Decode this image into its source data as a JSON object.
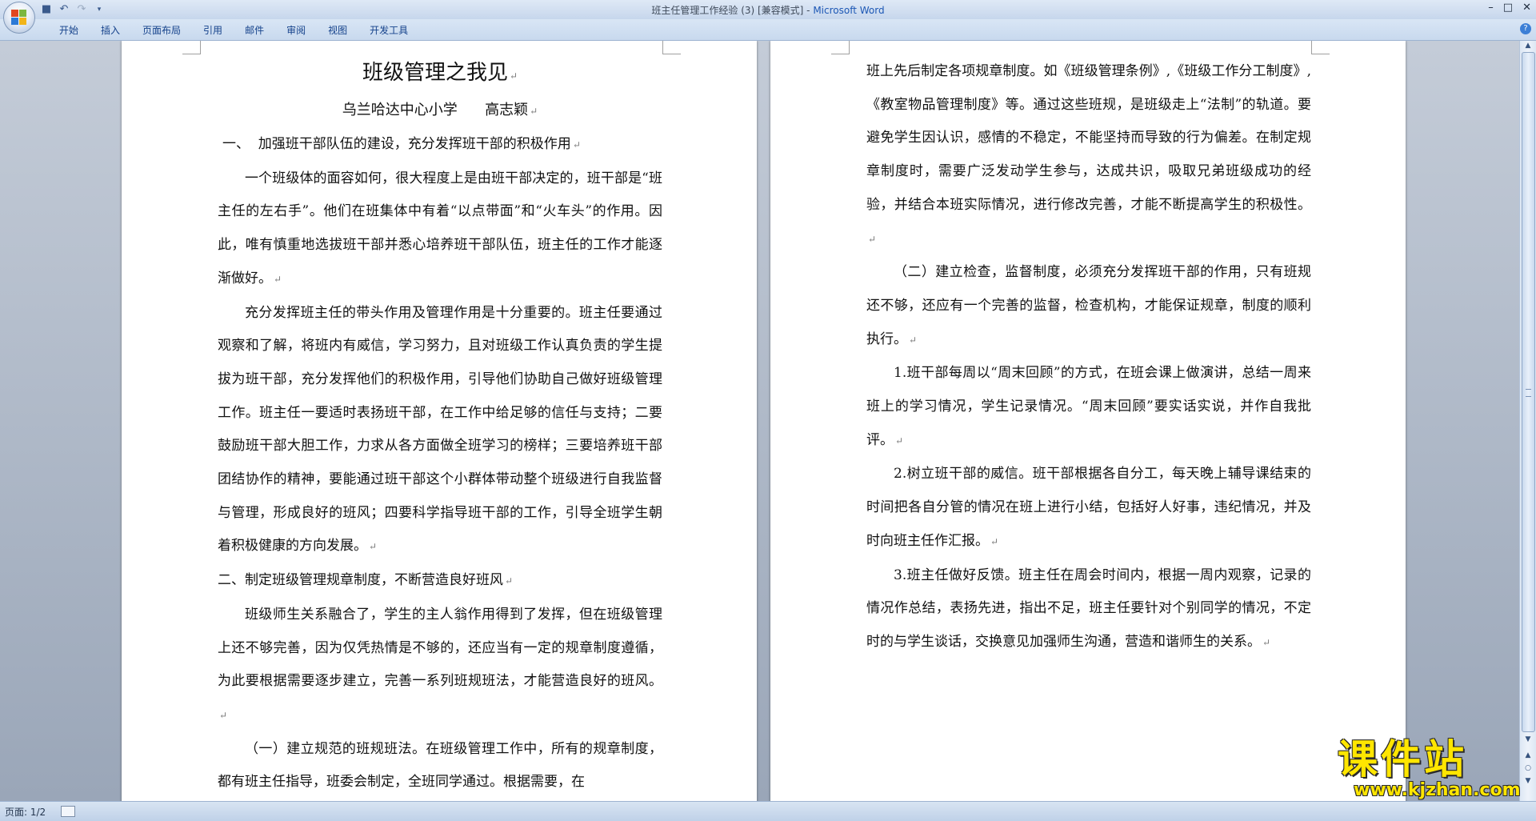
{
  "window": {
    "title": "班主任管理工作经验 (3) [兼容模式] - ",
    "app_name": "Microsoft Word",
    "minimize": "–",
    "maximize": "□",
    "close": "✕"
  },
  "qat": {
    "save_icon": "floppy-disk-icon",
    "undo_icon": "undo-icon",
    "redo_icon": "redo-icon",
    "customize_icon": "dropdown-icon"
  },
  "ribbon": {
    "tabs": [
      "开始",
      "插入",
      "页面布局",
      "引用",
      "邮件",
      "审阅",
      "视图",
      "开发工具"
    ],
    "help": "?"
  },
  "pages": {
    "left": {
      "title": "班级管理之我见",
      "author": "乌兰哈达中心小学      高志颖",
      "paragraphs": [
        {
          "style": "h1",
          "text": "一、  加强班干部队伍的建设，充分发挥班干部的积极作用"
        },
        {
          "style": "indent",
          "text": "一个班级体的面容如何，很大程度上是由班干部决定的，班干部是“班主任的左右手”。他们在班集体中有着“以点带面”和“火车头”的作用。因此，唯有慎重地选拔班干部并悉心培养班干部队伍，班主任的工作才能逐渐做好。"
        },
        {
          "style": "indent",
          "text": "充分发挥班主任的带头作用及管理作用是十分重要的。班主任要通过观察和了解，将班内有威信，学习努力，且对班级工作认真负责的学生提拔为班干部，充分发挥他们的积极作用，引导他们协助自己做好班级管理工作。班主任一要适时表扬班干部，在工作中给足够的信任与支持；二要鼓励班干部大胆工作，力求从各方面做全班学习的榜样；三要培养班干部团结协作的精神，要能通过班干部这个小群体带动整个班级进行自我监督与管理，形成良好的班风；四要科学指导班干部的工作，引导全班学生朝着积极健康的方向发展。"
        },
        {
          "style": "plain",
          "text": "二、制定班级管理规章制度，不断营造良好班风"
        },
        {
          "style": "indent",
          "text": "班级师生关系融合了，学生的主人翁作用得到了发挥，但在班级管理上还不够完善，因为仅凭热情是不够的，还应当有一定的规章制度遵循，为此要根据需要逐步建立，完善一系列班规班法，才能营造良好的班风。"
        },
        {
          "style": "indent",
          "text": "（一）建立规范的班规班法。在班级管理工作中，所有的规章制度，都有班主任指导，班委会制定，全班同学通过。根据需要，在"
        }
      ]
    },
    "right": {
      "paragraphs": [
        {
          "style": "plain",
          "text": "班上先后制定各项规章制度。如《班级管理条例》,《班级工作分工制度》,《教室物品管理制度》等。通过这些班规，是班级走上“法制”的轨道。要避免学生因认识，感情的不稳定，不能坚持而导致的行为偏差。在制定规章制度时，需要广泛发动学生参与，达成共识，吸取兄弟班级成功的经验，并结合本班实际情况，进行修改完善，才能不断提高学生的积极性。"
        },
        {
          "style": "indent",
          "text": "（二）建立检查，监督制度，必须充分发挥班干部的作用，只有班规还不够，还应有一个完善的监督，检查机构，才能保证规章，制度的顺利执行。"
        },
        {
          "style": "indent",
          "text": "1.班干部每周以“周末回顾”的方式，在班会课上做演讲，总结一周来班上的学习情况，学生记录情况。“周末回顾”要实话实说，并作自我批评。"
        },
        {
          "style": "indent",
          "text": "2.树立班干部的威信。班干部根据各自分工，每天晚上辅导课结束的时间把各自分管的情况在班上进行小结，包括好人好事，违纪情况，并及时向班主任作汇报。"
        },
        {
          "style": "indent",
          "text": "3.班主任做好反馈。班主任在周会时间内，根据一周内观察，记录的情况作总结，表扬先进，指出不足，班主任要针对个别同学的情况，不定时的与学生谈话，交换意见加强师生沟通，营造和谐师生的关系。"
        }
      ]
    },
    "paragraph_mark": "↵"
  },
  "statusbar": {
    "page_label": "页面: 1/2"
  },
  "watermark": {
    "big": "课件站",
    "small": "www.kjzhan.com"
  },
  "colors": {
    "ribbon_text": "#15428b",
    "app_name": "#1c57b5",
    "watermark": "#ffe600"
  }
}
